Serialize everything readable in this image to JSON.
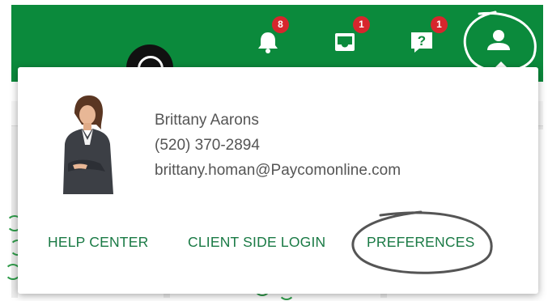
{
  "header": {
    "brand_color": "#0b8a3c",
    "icons": [
      {
        "name": "bell-icon",
        "badge": "8"
      },
      {
        "name": "inbox-icon",
        "badge": "1"
      },
      {
        "name": "help-icon",
        "badge": "1"
      },
      {
        "name": "user-icon"
      }
    ],
    "badge_color": "#d7262d"
  },
  "profile": {
    "name": "Brittany Aarons",
    "phone": "(520) 370-2894",
    "email": "brittany.homan@Paycomonline.com"
  },
  "links": {
    "help_center": "HELP CENTER",
    "client_side_login": "CLIENT SIDE LOGIN",
    "preferences": "PREFERENCES"
  },
  "link_color": "#1a7a45"
}
